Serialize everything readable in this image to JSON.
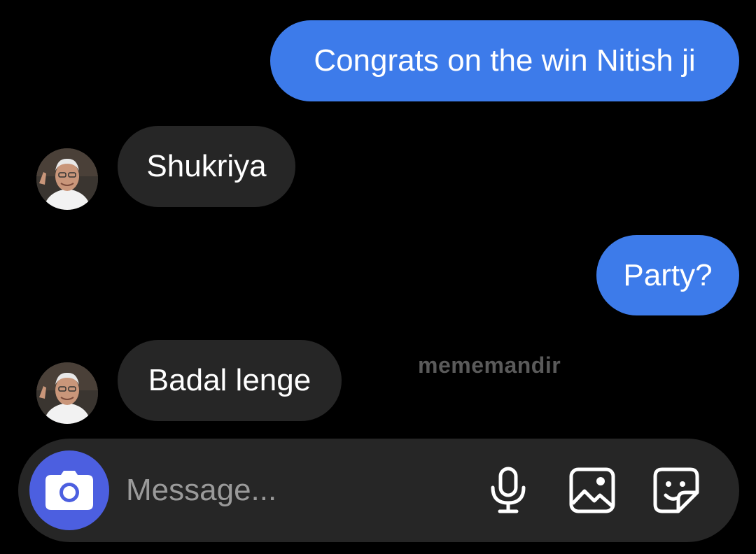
{
  "messages": [
    {
      "direction": "outgoing",
      "text": "Congrats on the win Nitish ji"
    },
    {
      "direction": "incoming",
      "text": "Shukriya"
    },
    {
      "direction": "outgoing",
      "text": "Party?"
    },
    {
      "direction": "incoming",
      "text": "Badal lenge"
    }
  ],
  "watermark": "mememandir",
  "composer": {
    "placeholder": "Message...",
    "camera_icon": "camera-icon",
    "mic_icon": "microphone-icon",
    "gallery_icon": "image-gallery-icon",
    "sticker_icon": "sticker-icon"
  },
  "colors": {
    "outgoing_bubble": "#3d7bea",
    "incoming_bubble": "#262626",
    "camera_button": "#4c5fe0",
    "background": "#000000"
  }
}
